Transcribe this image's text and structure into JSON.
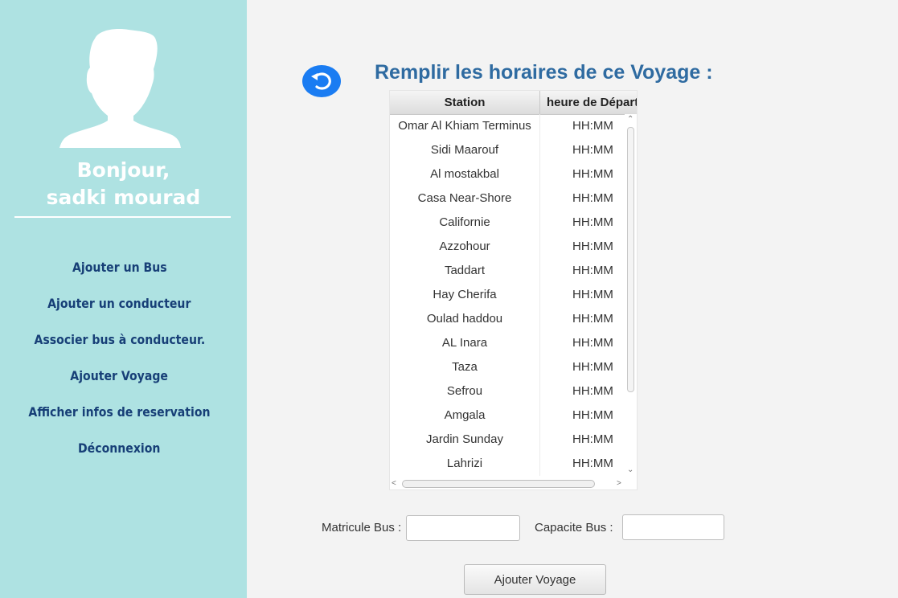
{
  "sidebar": {
    "greeting_line1": "Bonjour,",
    "greeting_line2": "sadki mourad",
    "menu": [
      {
        "label": "Ajouter un Bus"
      },
      {
        "label": "Ajouter un conducteur"
      },
      {
        "label": "Associer bus à conducteur."
      },
      {
        "label": "Ajouter Voyage"
      },
      {
        "label": "Afficher infos de reservation"
      },
      {
        "label": "Déconnexion"
      }
    ]
  },
  "main": {
    "title": "Remplir les horaires de ce Voyage :",
    "table": {
      "columns": [
        "Station",
        "heure de Départ"
      ],
      "rows": [
        {
          "station": "Omar Al Khiam Terminus",
          "heure": "HH:MM"
        },
        {
          "station": "Sidi Maarouf",
          "heure": "HH:MM"
        },
        {
          "station": "Al mostakbal",
          "heure": "HH:MM"
        },
        {
          "station": "Casa Near-Shore",
          "heure": "HH:MM"
        },
        {
          "station": "Californie",
          "heure": "HH:MM"
        },
        {
          "station": "Azzohour",
          "heure": "HH:MM"
        },
        {
          "station": "Taddart",
          "heure": "HH:MM"
        },
        {
          "station": "Hay Cherifa",
          "heure": "HH:MM"
        },
        {
          "station": "Oulad haddou",
          "heure": "HH:MM"
        },
        {
          "station": "AL Inara",
          "heure": "HH:MM"
        },
        {
          "station": "Taza",
          "heure": "HH:MM"
        },
        {
          "station": "Sefrou",
          "heure": "HH:MM"
        },
        {
          "station": "Amgala",
          "heure": "HH:MM"
        },
        {
          "station": "Jardin Sunday",
          "heure": "HH:MM"
        },
        {
          "station": "Lahrizi",
          "heure": "HH:MM"
        }
      ]
    },
    "form": {
      "matricule_label": "Matricule Bus :",
      "matricule_value": "",
      "capacite_label": "Capacite Bus :",
      "capacite_value": "",
      "submit_label": "Ajouter  Voyage"
    }
  },
  "icons": {
    "avatar": "user-avatar-icon",
    "back": "undo-icon"
  },
  "colors": {
    "sidebar_bg": "#aee2e2",
    "menu_text": "#173f77",
    "title_text": "#2f6ba1",
    "back_button": "#1a7cf2"
  }
}
